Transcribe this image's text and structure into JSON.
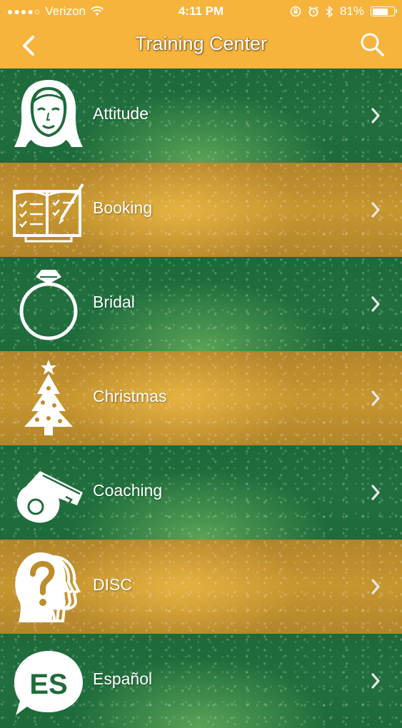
{
  "status_bar": {
    "carrier": "Verizon",
    "signal_dots": "●●●●○",
    "time": "4:11 PM",
    "battery_percent": "81%",
    "battery_level": 0.81
  },
  "nav": {
    "title": "Training Center",
    "back_icon": "chevron-left-icon",
    "search_icon": "search-icon"
  },
  "colors": {
    "header": "#f7b43c",
    "green_row": "#1f6b3b",
    "gold_row": "#bd8c2e",
    "text": "#ffffff"
  },
  "items": [
    {
      "label": "Attitude",
      "icon": "woman-face-icon",
      "color": "green"
    },
    {
      "label": "Booking",
      "icon": "open-book-icon",
      "color": "gold"
    },
    {
      "label": "Bridal",
      "icon": "diamond-ring-icon",
      "color": "green"
    },
    {
      "label": "Christmas",
      "icon": "christmas-tree-icon",
      "color": "gold"
    },
    {
      "label": "Coaching",
      "icon": "whistle-icon",
      "color": "green"
    },
    {
      "label": "DISC",
      "icon": "head-question-icon",
      "color": "gold"
    },
    {
      "label": "Español",
      "icon": "es-speech-bubble-icon",
      "color": "green"
    }
  ]
}
